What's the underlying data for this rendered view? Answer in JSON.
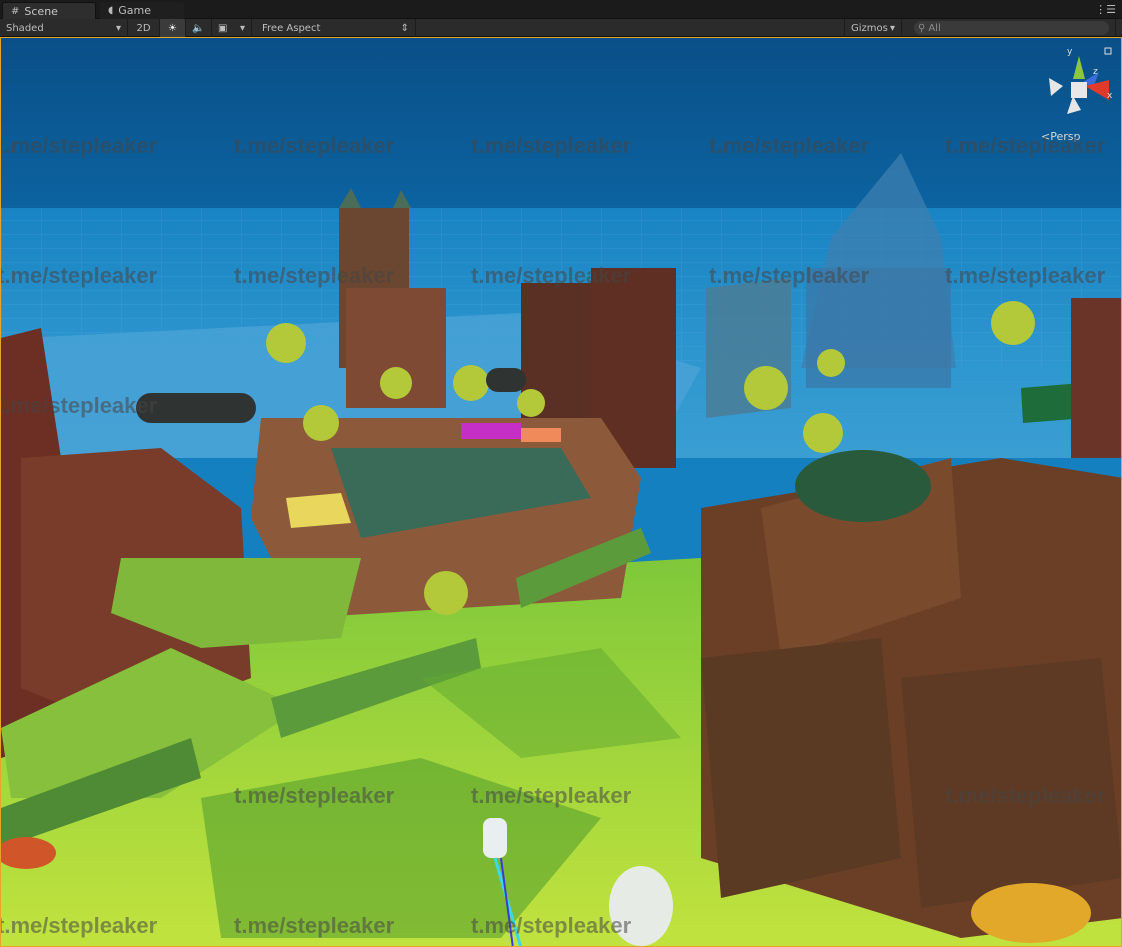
{
  "tabs": [
    {
      "label": "Scene",
      "icon": "grid-icon",
      "active": true
    },
    {
      "label": "Game",
      "icon": "pacman-icon",
      "active": false
    }
  ],
  "toolbar": {
    "shading_mode": "Shaded",
    "mode_2d": "2D",
    "lighting_icon": "sun-icon",
    "audio_icon": "speaker-icon",
    "effects_icon": "image-icon",
    "aspect": "Free Aspect",
    "gizmos": "Gizmos",
    "search_placeholder": "All"
  },
  "viewport": {
    "projection_label": "Persp",
    "axes": {
      "x": "x",
      "y": "y",
      "z": "z"
    },
    "border_color": "#e7a32a",
    "sky_color": "#0d5e9a"
  },
  "watermark": {
    "text": "t.me/stepleaker"
  }
}
